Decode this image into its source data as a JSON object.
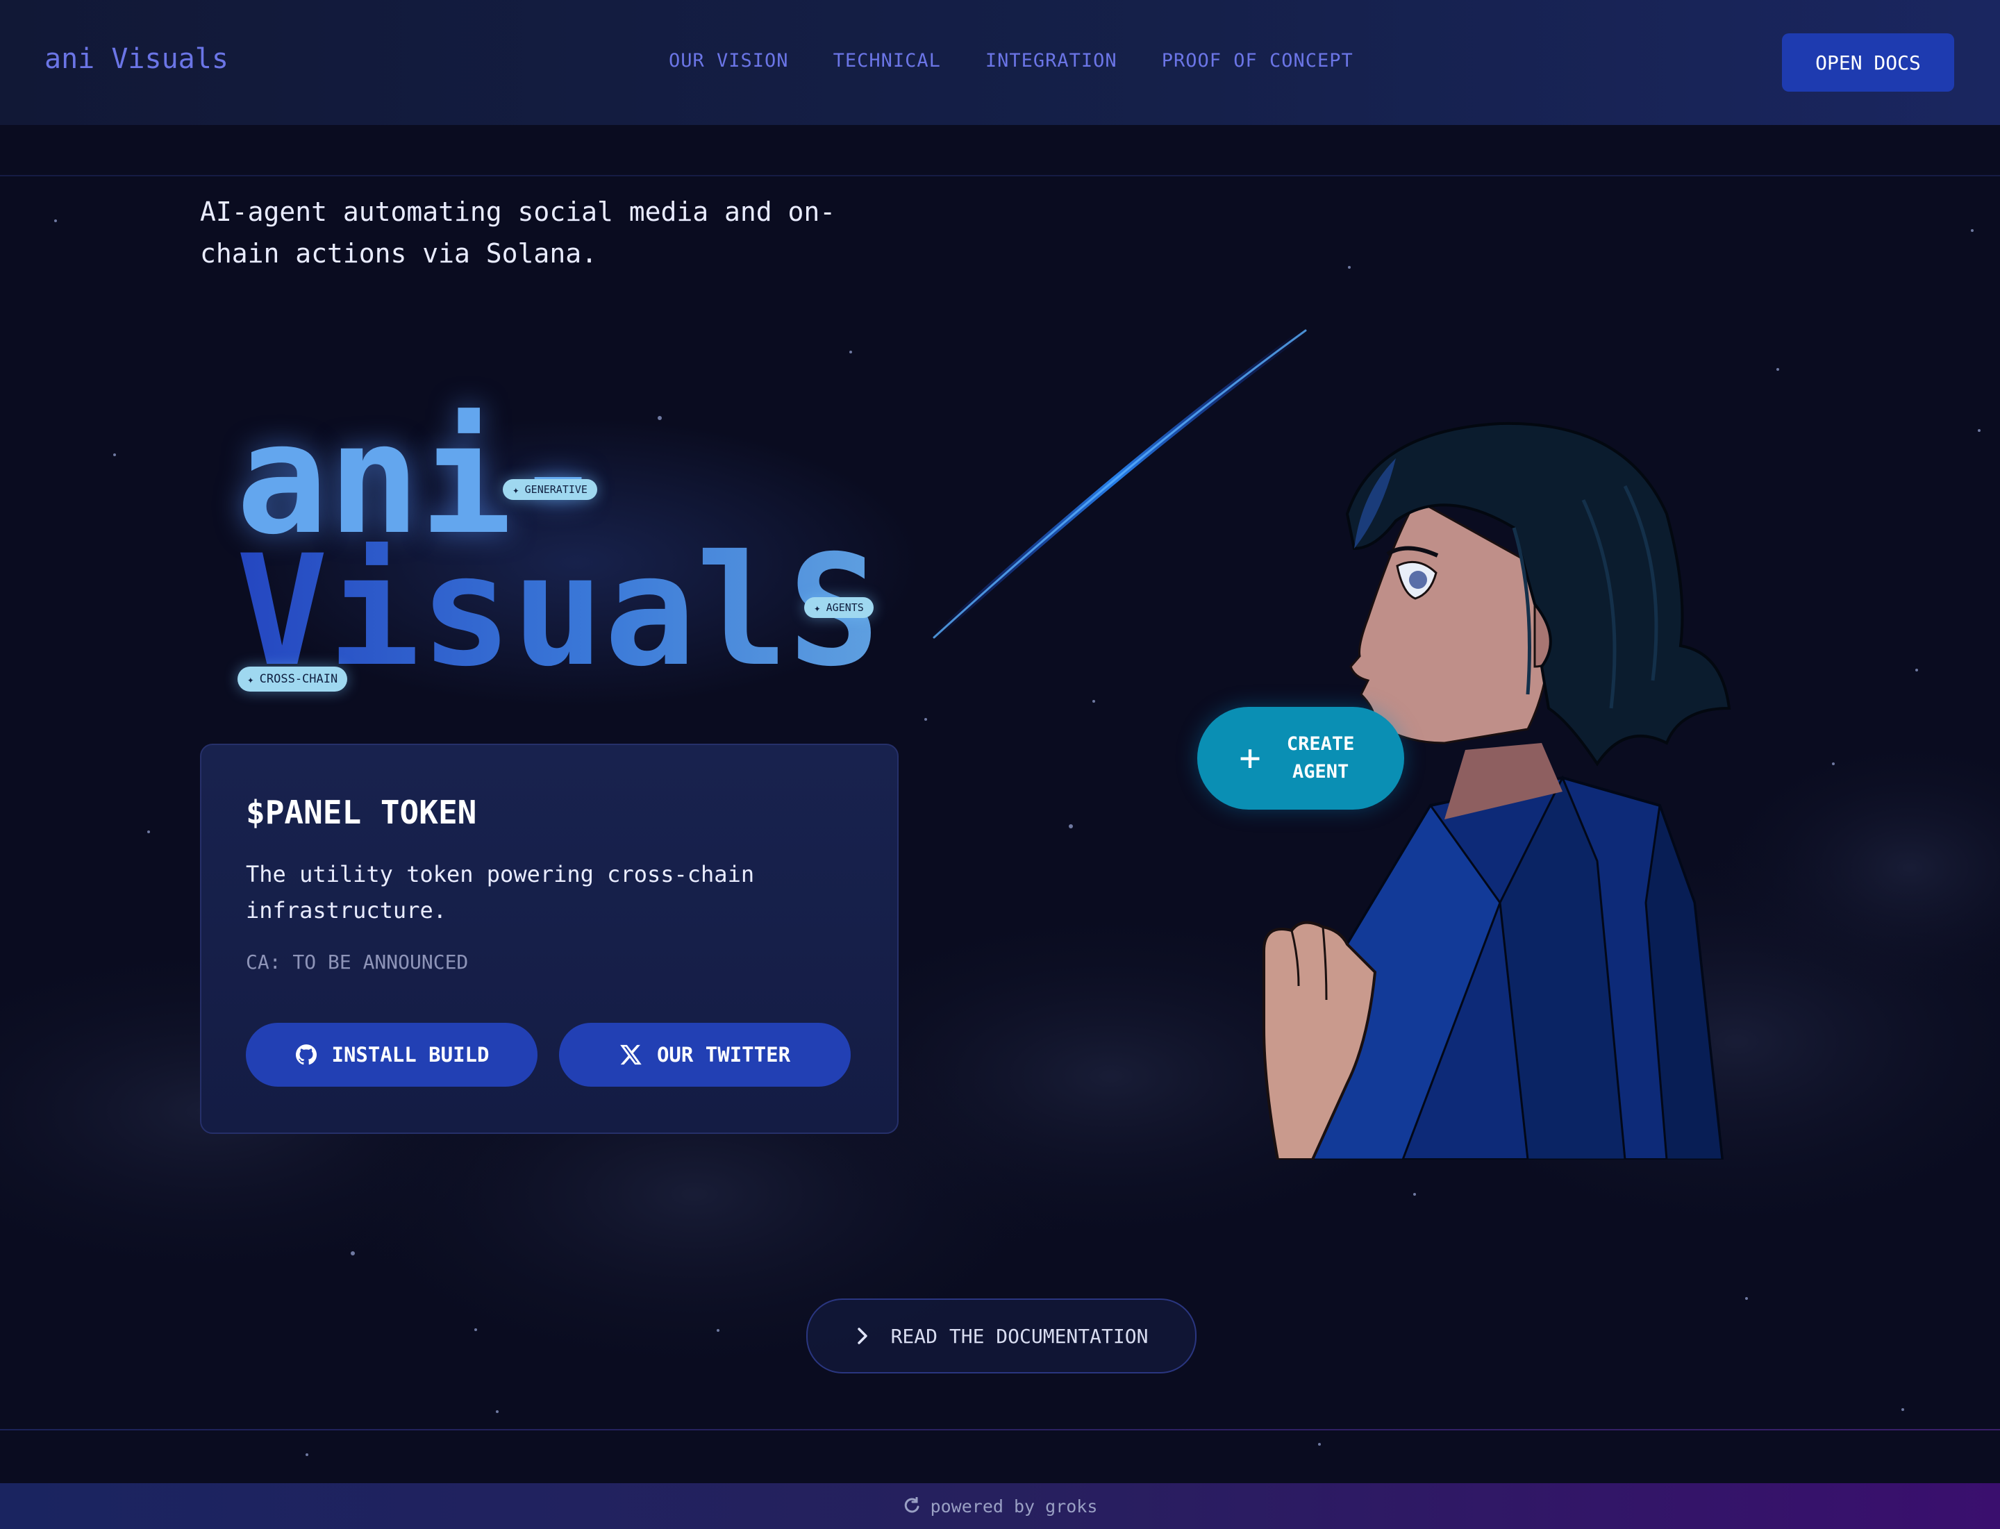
{
  "header": {
    "logo": "ani Visuals",
    "nav": [
      "OUR VISION",
      "TECHNICAL",
      "INTEGRATION",
      "PROOF OF CONCEPT"
    ],
    "open_docs": "OPEN DOCS"
  },
  "hero": {
    "tagline": "AI-agent automating social media and on-chain actions via Solana.",
    "title_line1": "ani-",
    "title_line2": "VisualS",
    "chips": {
      "generative": "GENERATIVE",
      "agents": "AGENTS",
      "cross_chain": "CROSS-CHAIN"
    }
  },
  "token_panel": {
    "title": "$PANEL TOKEN",
    "description": "The utility token powering cross-chain infrastructure.",
    "ca": "CA: TO BE ANNOUNCED",
    "install_button": "INSTALL BUILD",
    "twitter_button": "OUR TWITTER"
  },
  "create_agent": "CREATE AGENT",
  "read_docs": "READ THE DOCUMENTATION",
  "footer": {
    "text": "powered by groks"
  },
  "colors": {
    "accent": "#6b75e6",
    "button": "#2240b4",
    "teal": "#0a8fb4",
    "background": "#0a0c20"
  },
  "icons": {
    "github": "github-icon",
    "x": "x-icon",
    "plus": "plus-icon",
    "chevron": "chevron-right-icon",
    "footer": "refresh-icon",
    "sparkle": "sparkle-icon"
  }
}
